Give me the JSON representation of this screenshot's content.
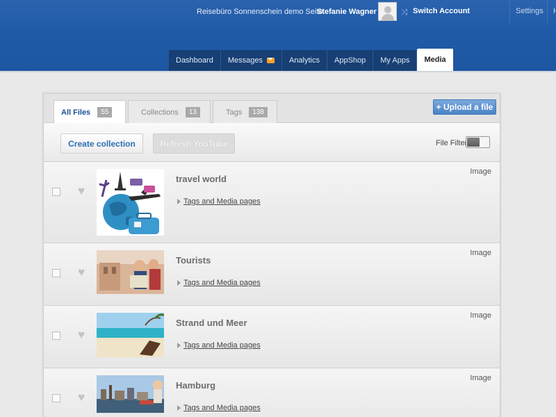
{
  "header": {
    "site_name": "Reisebüro Sonnenschein demo Seite",
    "user_name": "Stefanie Wagner",
    "switch_account": "Switch Account",
    "settings": "Settings",
    "extra": "H"
  },
  "nav": {
    "tabs": [
      {
        "label": "Dashboard"
      },
      {
        "label": "Messages"
      },
      {
        "label": "Analytics"
      },
      {
        "label": "AppShop"
      },
      {
        "label": "My Apps"
      },
      {
        "label": "Media"
      }
    ],
    "active": "Media"
  },
  "media": {
    "tabs": [
      {
        "label": "All Files",
        "count": "55"
      },
      {
        "label": "Collections",
        "count": "13"
      },
      {
        "label": "Tags",
        "count": "138"
      }
    ],
    "upload_label": "+ Upload a file",
    "create_collection": "Create collection",
    "refresh_youtube": "Refresh YouTube",
    "file_filter": "File Filter",
    "items": [
      {
        "title": "travel world",
        "tags_link": "Tags and Media pages",
        "type": "Image",
        "thumb": "travel-world-thumb"
      },
      {
        "title": "Tourists",
        "tags_link": "Tags and Media pages",
        "type": "Image",
        "thumb": "tourists-thumb"
      },
      {
        "title": "Strand und Meer",
        "tags_link": "Tags and Media pages",
        "type": "Image",
        "thumb": "beach-thumb"
      },
      {
        "title": "Hamburg",
        "tags_link": "Tags and Media pages",
        "type": "Image",
        "thumb": "hamburg-thumb"
      }
    ]
  },
  "colors": {
    "header_blue": "#1e5aa8",
    "accent_blue": "#2c6fb6",
    "mail_orange": "#f6a12b"
  }
}
